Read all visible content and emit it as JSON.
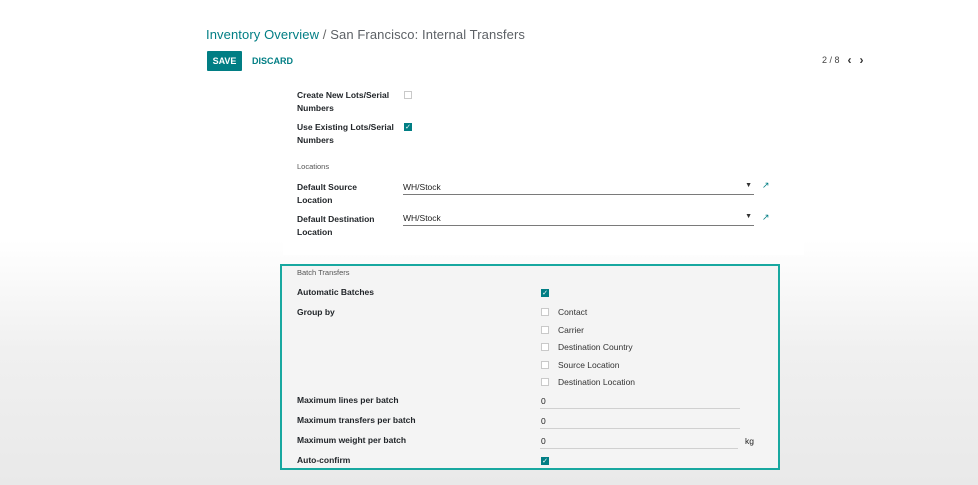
{
  "breadcrumb": {
    "parent": "Inventory Overview",
    "separator": "/",
    "current": "San Francisco: Internal Transfers"
  },
  "toolbar": {
    "save_label": "SAVE",
    "discard_label": "DISCARD"
  },
  "pager": {
    "value": "2 / 8",
    "prev_icon": "chevron-left-icon",
    "next_icon": "chevron-right-icon"
  },
  "form": {
    "create_lots_label": "Create New Lots/Serial Numbers",
    "create_lots_checked": false,
    "use_existing_lots_label": "Use Existing Lots/Serial Numbers",
    "use_existing_lots_checked": true,
    "locations_section": "Locations",
    "default_source_label": "Default Source Location",
    "default_source_value": "WH/Stock",
    "default_destination_label": "Default Destination Location",
    "default_destination_value": "WH/Stock"
  },
  "batch": {
    "section_title": "Batch Transfers",
    "automatic_batches_label": "Automatic Batches",
    "automatic_batches_checked": true,
    "group_by_label": "Group by",
    "group_by_options": [
      {
        "label": "Contact",
        "checked": false
      },
      {
        "label": "Carrier",
        "checked": false
      },
      {
        "label": "Destination Country",
        "checked": false
      },
      {
        "label": "Source Location",
        "checked": false
      },
      {
        "label": "Destination Location",
        "checked": false
      }
    ],
    "max_lines_label": "Maximum lines per batch",
    "max_lines_value": "0",
    "max_transfers_label": "Maximum transfers per batch",
    "max_transfers_value": "0",
    "max_weight_label": "Maximum weight per batch",
    "max_weight_value": "0",
    "weight_unit": "kg",
    "auto_confirm_label": "Auto-confirm",
    "auto_confirm_checked": true
  },
  "colors": {
    "accent": "#017e84",
    "highlight_border": "#18a8a0"
  }
}
